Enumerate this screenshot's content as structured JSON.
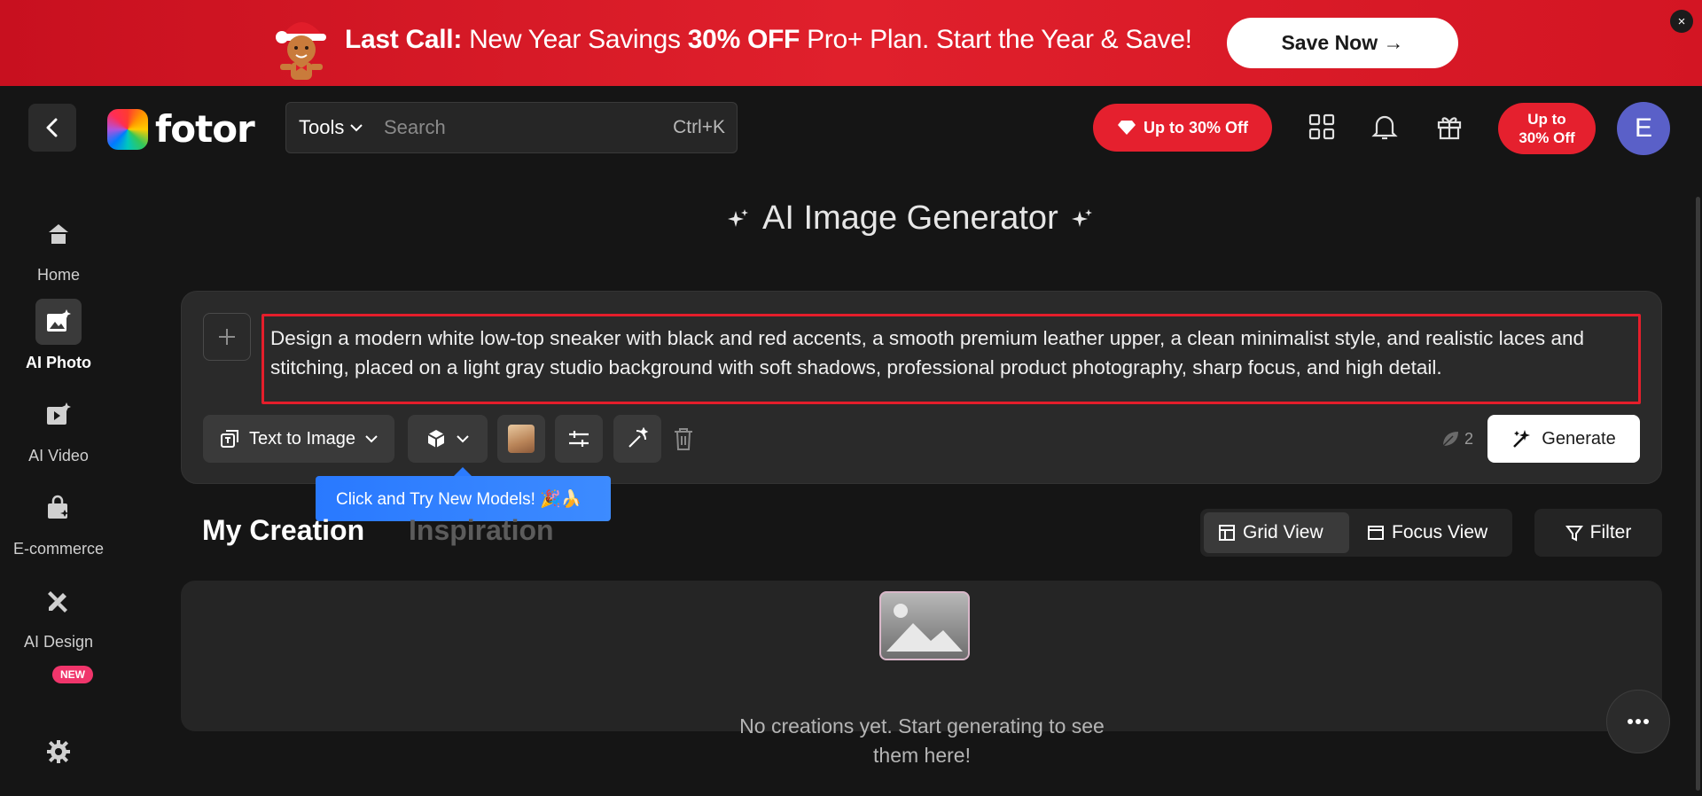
{
  "banner": {
    "headline_bold": "Last Call:",
    "headline": " New Year Savings ",
    "offer_bold": "30% OFF",
    "offer_rest": " Pro+ Plan. Start the Year & Save!",
    "cta": "Save Now →",
    "close": "×"
  },
  "nav": {
    "logo_text": "fotor",
    "tools_label": "Tools",
    "search_placeholder": "Search",
    "shortcut": "Ctrl+K",
    "offer_pill": "Up to 30% Off",
    "offer_circle_line1": "Up to",
    "offer_circle_line2": "30% Off",
    "avatar_initial": "E"
  },
  "sidebar": {
    "items": [
      {
        "label": "Home",
        "icon": "home-icon"
      },
      {
        "label": "AI Photo",
        "icon": "ai-photo-icon"
      },
      {
        "label": "AI Video",
        "icon": "ai-video-icon"
      },
      {
        "label": "E-commerce",
        "icon": "shopping-bag-icon"
      },
      {
        "label": "AI Design",
        "icon": "design-tools-icon"
      }
    ],
    "new_badge": "NEW"
  },
  "main": {
    "title": "AI Image Generator",
    "prompt_text": "Design a modern white low-top sneaker with black and red accents, a smooth premium leather upper, a clean minimalist style, and realistic laces and stitching, placed on a light gray studio background with soft shadows, professional product photography, sharp focus, and high detail.",
    "mode_label": "Text to Image",
    "credits": "2",
    "generate_label": "Generate",
    "tooltip": "Click and Try New Models! 🎉🍌",
    "tab_my_creation": "My Creation",
    "tab_inspiration": "Inspiration",
    "grid_view": "Grid View",
    "focus_view": "Focus View",
    "filter": "Filter",
    "empty_text": "No creations yet. Start generating to see them here!"
  },
  "colors": {
    "accent_red": "#e5202e",
    "tooltip_blue": "#2b7bff",
    "background": "#151515",
    "avatar": "#5a60c8"
  }
}
